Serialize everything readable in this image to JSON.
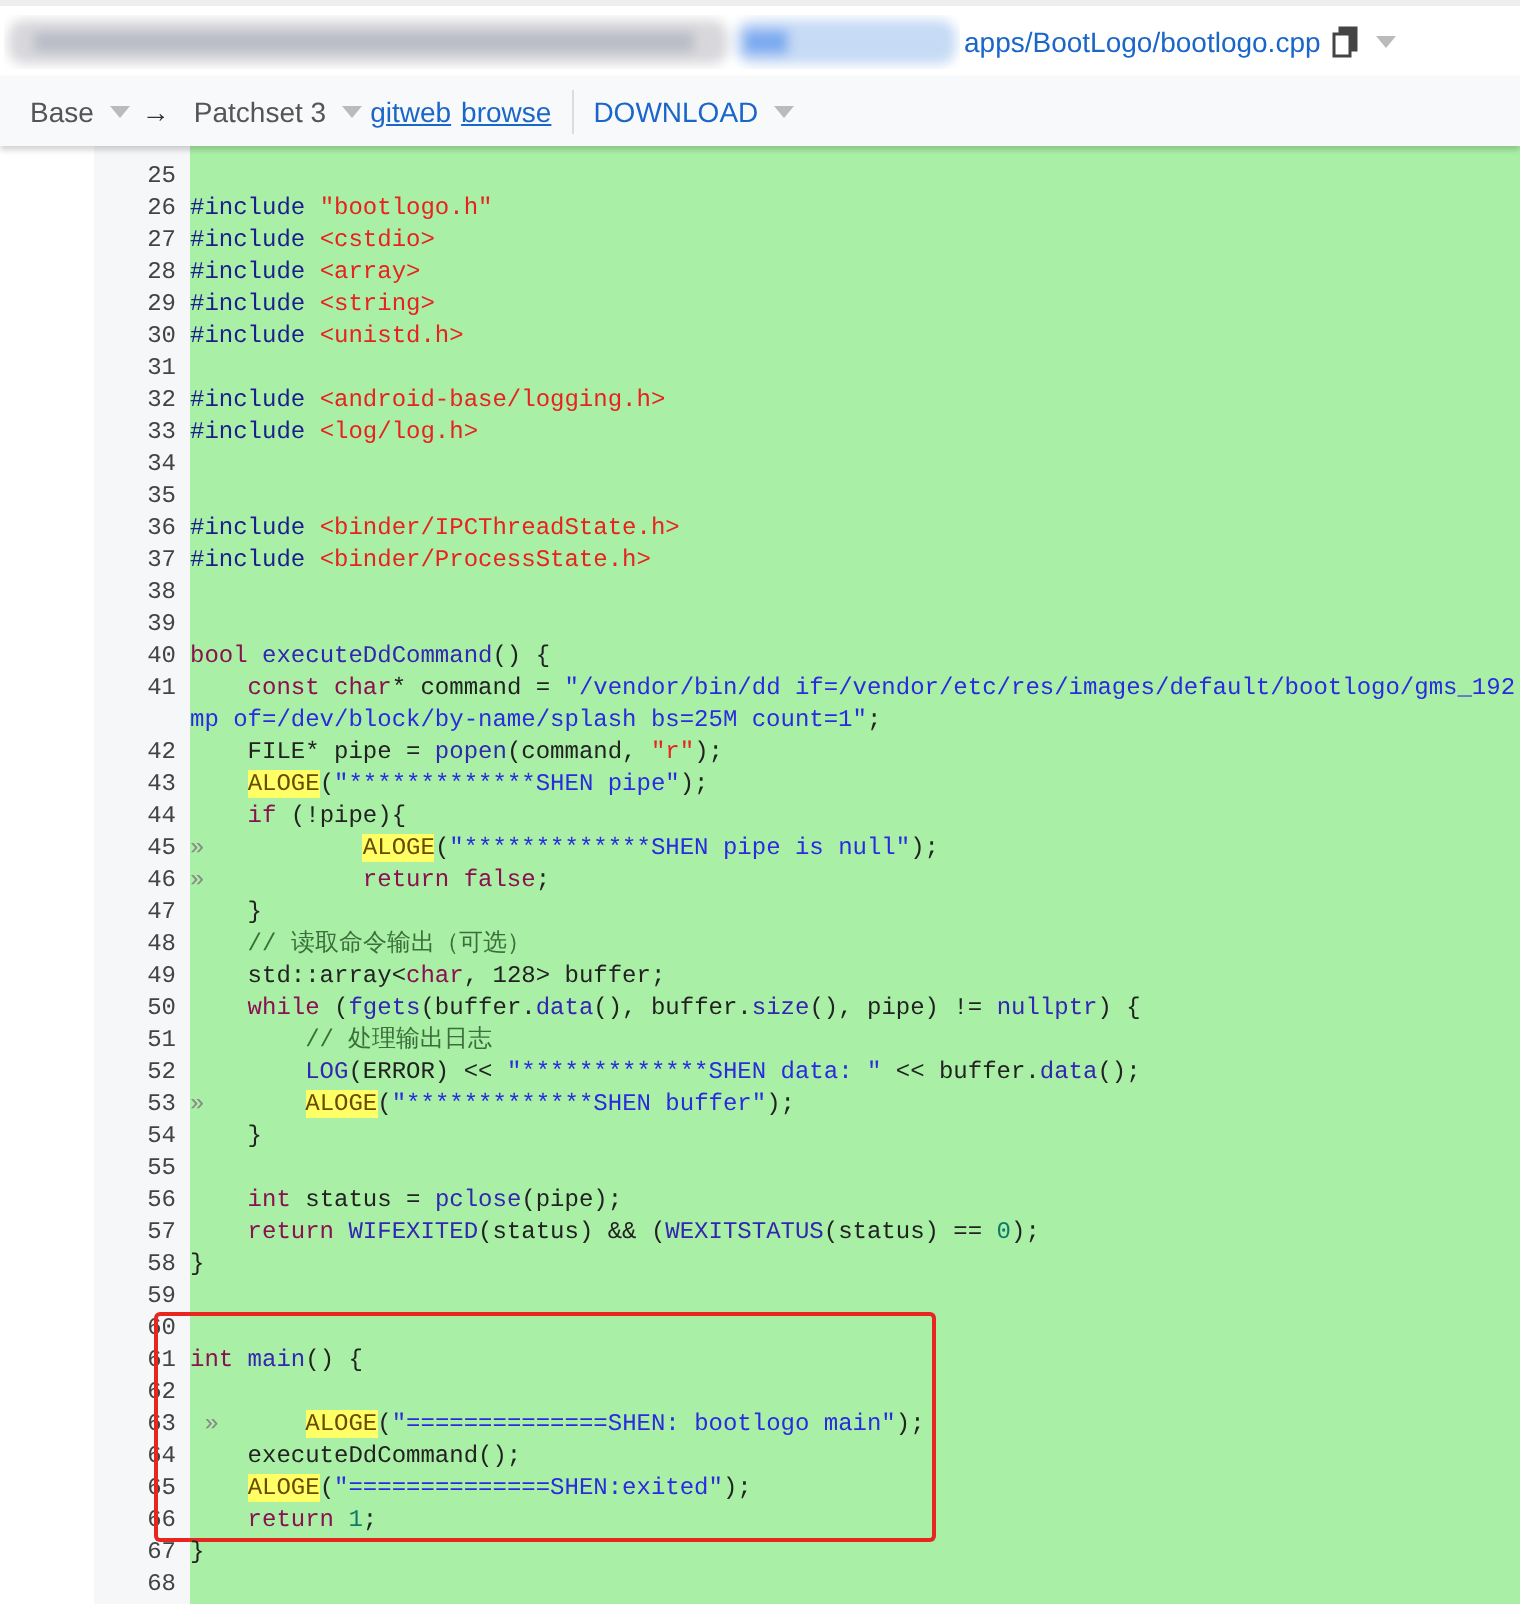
{
  "file_bar": {
    "path": "apps/BootLogo/bootlogo.cpp"
  },
  "toolbar": {
    "base": "Base",
    "arrow": "→",
    "patchset": "Patchset 3",
    "links": [
      "gitweb",
      "browse"
    ],
    "download": "DOWNLOAD"
  },
  "code_lines": [
    {
      "number": "25",
      "framed": false
    },
    {
      "number": "26",
      "framed": false,
      "tokens": [
        {
          "kind": "pp",
          "text": "#include "
        },
        {
          "kind": "inc",
          "text": "\"bootlogo.h\""
        }
      ]
    },
    {
      "number": "27",
      "framed": false,
      "tokens": [
        {
          "kind": "pp",
          "text": "#include "
        },
        {
          "kind": "inc",
          "text": "<cstdio>"
        }
      ]
    },
    {
      "number": "28",
      "framed": false,
      "tokens": [
        {
          "kind": "pp",
          "text": "#include "
        },
        {
          "kind": "inc",
          "text": "<array>"
        }
      ]
    },
    {
      "number": "29",
      "framed": false,
      "tokens": [
        {
          "kind": "pp",
          "text": "#include "
        },
        {
          "kind": "inc",
          "text": "<string>"
        }
      ]
    },
    {
      "number": "30",
      "framed": false,
      "tokens": [
        {
          "kind": "pp",
          "text": "#include "
        },
        {
          "kind": "inc",
          "text": "<unistd.h>"
        }
      ]
    },
    {
      "number": "31",
      "framed": false
    },
    {
      "number": "32",
      "framed": false,
      "tokens": [
        {
          "kind": "pp",
          "text": "#include "
        },
        {
          "kind": "inc",
          "text": "<android-base/logging.h>"
        }
      ]
    },
    {
      "number": "33",
      "framed": false,
      "tokens": [
        {
          "kind": "pp",
          "text": "#include "
        },
        {
          "kind": "inc",
          "text": "<log/log.h>"
        }
      ]
    },
    {
      "number": "34",
      "framed": false
    },
    {
      "number": "35",
      "framed": false
    },
    {
      "number": "36",
      "framed": false,
      "tokens": [
        {
          "kind": "pp",
          "text": "#include "
        },
        {
          "kind": "inc",
          "text": "<binder/IPCThreadState.h>"
        }
      ]
    },
    {
      "number": "37",
      "framed": false,
      "tokens": [
        {
          "kind": "pp",
          "text": "#include "
        },
        {
          "kind": "inc",
          "text": "<binder/ProcessState.h>"
        }
      ]
    },
    {
      "number": "38",
      "framed": false
    },
    {
      "number": "39",
      "framed": false
    },
    {
      "number": "40",
      "framed": false,
      "tokens": [
        {
          "kind": "kw",
          "text": "bool"
        },
        {
          "kind": "fn",
          "text": " executeDdCommand"
        },
        {
          "kind": "plain",
          "text": "() {"
        }
      ]
    },
    {
      "number": "41",
      "framed": false,
      "tokens": [
        {
          "kind": "kw",
          "text": "    const char"
        },
        {
          "kind": "plain",
          "text": "* command = "
        },
        {
          "kind": "str",
          "text": "\"/vendor/bin/dd if=/vendor/etc/res/images/default/bootlogo/gms_192"
        }
      ]
    },
    {
      "framed": false,
      "tokens": [
        {
          "kind": "str",
          "text": "mp of=/dev/block/by-name/splash bs=25M count=1\""
        },
        {
          "kind": "plain",
          "text": ";"
        }
      ]
    },
    {
      "number": "42",
      "framed": false,
      "tokens": [
        {
          "kind": "plain",
          "text": "    FILE* pipe = "
        },
        {
          "kind": "fn",
          "text": "popen"
        },
        {
          "kind": "plain",
          "text": "(command, "
        },
        {
          "kind": "inc",
          "text": "\"r\""
        },
        {
          "kind": "plain",
          "text": ");"
        }
      ]
    },
    {
      "number": "43",
      "framed": false,
      "tokens": [
        {
          "kind": "hl",
          "text": "    ALOGE"
        },
        {
          "kind": "plain",
          "text": "("
        },
        {
          "kind": "str",
          "text": "\"*************SHEN pipe\""
        },
        {
          "kind": "plain",
          "text": ");"
        }
      ]
    },
    {
      "number": "44",
      "framed": false,
      "tokens": [
        {
          "kind": "kw",
          "text": "    if"
        },
        {
          "kind": "plain",
          "text": " (!pipe){"
        }
      ]
    },
    {
      "number": "45",
      "framed": false,
      "tokens": [
        {
          "kind": "tab",
          "text": "»"
        },
        {
          "kind": "hl",
          "text": "           ALOGE"
        },
        {
          "kind": "plain",
          "text": "("
        },
        {
          "kind": "str",
          "text": "\"*************SHEN pipe is null\""
        },
        {
          "kind": "plain",
          "text": ");"
        }
      ]
    },
    {
      "number": "46",
      "framed": false,
      "tokens": [
        {
          "kind": "tab",
          "text": "»"
        },
        {
          "kind": "kw",
          "text": "           return false"
        },
        {
          "kind": "plain",
          "text": ";"
        }
      ]
    },
    {
      "number": "47",
      "framed": false,
      "tokens": [
        {
          "kind": "plain",
          "text": "    }"
        }
      ]
    },
    {
      "number": "48",
      "framed": false,
      "tokens": [
        {
          "kind": "com",
          "text": "    // 读取命令输出（可选）"
        }
      ]
    },
    {
      "number": "49",
      "framed": false,
      "tokens": [
        {
          "kind": "plain",
          "text": "    std::array<"
        },
        {
          "kind": "kw",
          "text": "char"
        },
        {
          "kind": "plain",
          "text": ", 128> buffer;"
        }
      ]
    },
    {
      "number": "50",
      "framed": false,
      "tokens": [
        {
          "kind": "kw",
          "text": "    while"
        },
        {
          "kind": "plain",
          "text": " ("
        },
        {
          "kind": "fn",
          "text": "fgets"
        },
        {
          "kind": "plain",
          "text": "(buffer."
        },
        {
          "kind": "fn",
          "text": "data"
        },
        {
          "kind": "plain",
          "text": "(), buffer."
        },
        {
          "kind": "fn",
          "text": "size"
        },
        {
          "kind": "plain",
          "text": "(), pipe) != "
        },
        {
          "kind": "fn",
          "text": "nullptr"
        },
        {
          "kind": "plain",
          "text": ") {"
        }
      ]
    },
    {
      "number": "51",
      "framed": false,
      "tokens": [
        {
          "kind": "com",
          "text": "        // 处理输出日志"
        }
      ]
    },
    {
      "number": "52",
      "framed": false,
      "tokens": [
        {
          "kind": "fn",
          "text": "        LOG"
        },
        {
          "kind": "plain",
          "text": "(ERROR) << "
        },
        {
          "kind": "str",
          "text": "\"*************SHEN data: \""
        },
        {
          "kind": "plain",
          "text": " << buffer."
        },
        {
          "kind": "fn",
          "text": "data"
        },
        {
          "kind": "plain",
          "text": "();"
        }
      ]
    },
    {
      "number": "53",
      "framed": false,
      "tokens": [
        {
          "kind": "tab",
          "text": "»"
        },
        {
          "kind": "hl",
          "text": "       ALOGE"
        },
        {
          "kind": "plain",
          "text": "("
        },
        {
          "kind": "str",
          "text": "\"*************SHEN buffer\""
        },
        {
          "kind": "plain",
          "text": ");"
        }
      ]
    },
    {
      "number": "54",
      "framed": false,
      "tokens": [
        {
          "kind": "plain",
          "text": "    }"
        }
      ]
    },
    {
      "number": "55",
      "framed": false
    },
    {
      "number": "56",
      "framed": false,
      "tokens": [
        {
          "kind": "kw",
          "text": "    int"
        },
        {
          "kind": "plain",
          "text": " status = "
        },
        {
          "kind": "fn",
          "text": "pclose"
        },
        {
          "kind": "plain",
          "text": "(pipe);"
        }
      ]
    },
    {
      "number": "57",
      "framed": false,
      "tokens": [
        {
          "kind": "kw",
          "text": "    return"
        },
        {
          "kind": "fn",
          "text": " WIFEXITED"
        },
        {
          "kind": "plain",
          "text": "(status) && ("
        },
        {
          "kind": "fn",
          "text": "WEXITSTATUS"
        },
        {
          "kind": "plain",
          "text": "(status) == "
        },
        {
          "kind": "num",
          "text": "0"
        },
        {
          "kind": "plain",
          "text": ");"
        }
      ]
    },
    {
      "number": "58",
      "framed": false,
      "tokens": [
        {
          "kind": "plain",
          "text": "}"
        }
      ]
    },
    {
      "number": "59",
      "framed": false
    },
    {
      "number": "60",
      "framed": true
    },
    {
      "number": "61",
      "framed": true,
      "tokens": [
        {
          "kind": "kw",
          "text": "int"
        },
        {
          "kind": "fn",
          "text": " main"
        },
        {
          "kind": "plain",
          "text": "() {"
        }
      ]
    },
    {
      "number": "62",
      "framed": true
    },
    {
      "number": "63",
      "framed": true,
      "tokens": [
        {
          "kind": "tab",
          "text": " »"
        },
        {
          "kind": "hl",
          "text": "      ALOGE"
        },
        {
          "kind": "plain",
          "text": "("
        },
        {
          "kind": "str",
          "text": "\"==============SHEN: bootlogo main\""
        },
        {
          "kind": "plain",
          "text": ");"
        }
      ]
    },
    {
      "number": "64",
      "framed": true,
      "tokens": [
        {
          "kind": "plain",
          "text": "    executeDdCommand();"
        }
      ]
    },
    {
      "number": "65",
      "framed": true,
      "tokens": [
        {
          "kind": "hl",
          "text": "    ALOGE"
        },
        {
          "kind": "plain",
          "text": "("
        },
        {
          "kind": "str",
          "text": "\"==============SHEN:exited\""
        },
        {
          "kind": "plain",
          "text": ");"
        }
      ]
    },
    {
      "number": "66",
      "framed": true,
      "tokens": [
        {
          "kind": "kw",
          "text": "    return"
        },
        {
          "kind": "num",
          "text": " 1"
        },
        {
          "kind": "plain",
          "text": ";"
        }
      ]
    },
    {
      "number": "67",
      "framed": false,
      "tokens": [
        {
          "kind": "plain",
          "text": "}"
        }
      ]
    },
    {
      "number": "68",
      "framed": false
    }
  ]
}
